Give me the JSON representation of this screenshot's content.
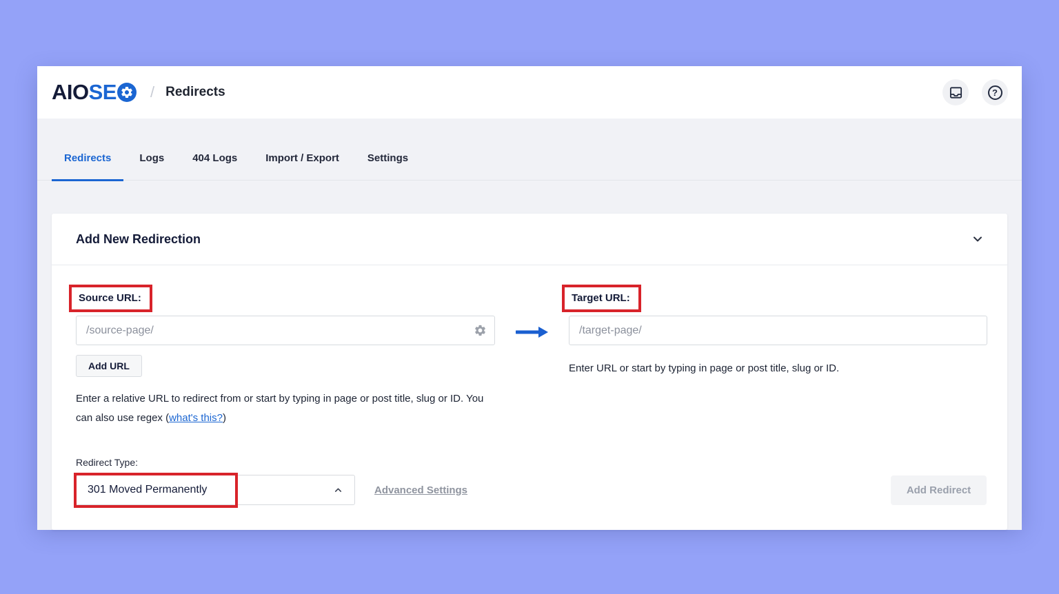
{
  "colors": {
    "page_background": "#94A2F8",
    "accent_blue": "#1B66D2",
    "brand_navy": "#141B38",
    "annotation_red": "#D8232A"
  },
  "header": {
    "logo_part1": "AIO",
    "logo_part2": "SE",
    "logo_gear_icon": "gear-icon",
    "breadcrumb_separator": "/",
    "page_title": "Redirects",
    "notifications_icon": "inbox-icon",
    "help_icon": "question-mark-icon"
  },
  "tabs": [
    {
      "label": "Redirects",
      "active": true
    },
    {
      "label": "Logs",
      "active": false
    },
    {
      "label": "404 Logs",
      "active": false
    },
    {
      "label": "Import / Export",
      "active": false
    },
    {
      "label": "Settings",
      "active": false
    }
  ],
  "card": {
    "title": "Add New Redirection",
    "collapse_icon": "chevron-down-icon"
  },
  "form": {
    "source": {
      "label": "Source URL:",
      "value": "",
      "placeholder": "/source-page/",
      "options_icon": "gear-icon",
      "add_url_button": "Add URL",
      "helper_before_link": "Enter a relative URL to redirect from or start by typing in page or post title, slug or ID. You can also use regex (",
      "helper_link": "what's this?",
      "helper_after_link": ")"
    },
    "arrow_icon": "right-arrow-icon",
    "target": {
      "label": "Target URL:",
      "value": "",
      "placeholder": "/target-page/",
      "helper": "Enter URL or start by typing in page or post title, slug or ID."
    },
    "redirect_type": {
      "label": "Redirect Type:",
      "value": "301 Moved Permanently",
      "caret_icon": "chevron-up-icon"
    },
    "advanced_settings_label": "Advanced Settings",
    "add_redirect_button": "Add Redirect"
  },
  "annotations": {
    "highlight_color": "#D8232A",
    "highlighted": [
      "Source URL label",
      "Target URL label",
      "Redirect type value"
    ]
  }
}
